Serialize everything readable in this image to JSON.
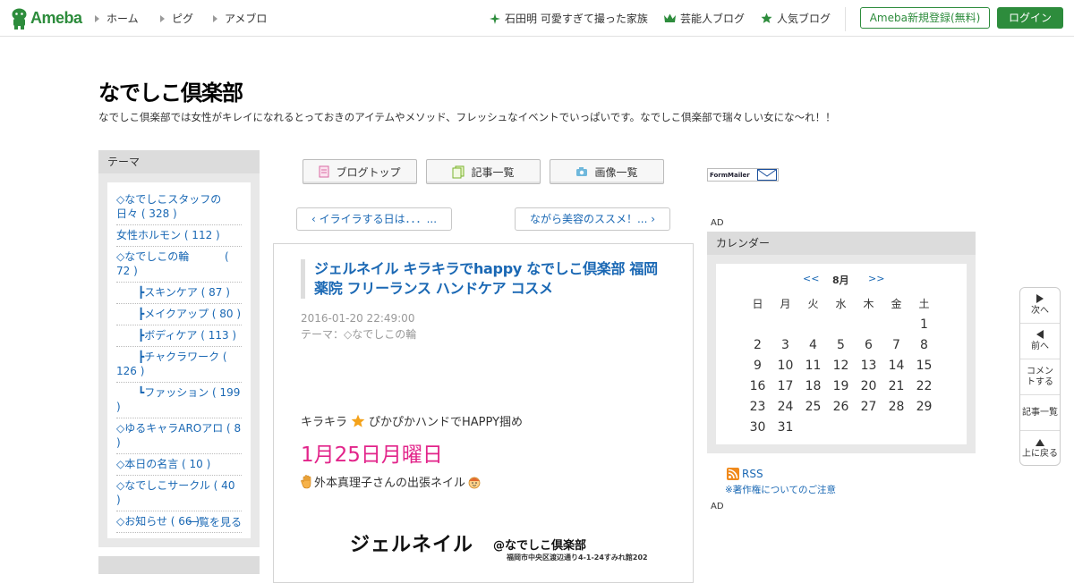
{
  "header": {
    "logo_text": "Ameba",
    "nav": [
      "ホーム",
      "ピグ",
      "アメブロ"
    ],
    "links": [
      {
        "label": "石田明 可愛すぎて撮った家族",
        "icon": "sparkle-icon"
      },
      {
        "label": "芸能人ブログ",
        "icon": "crown-icon"
      },
      {
        "label": "人気ブログ",
        "icon": "star-icon"
      }
    ],
    "register_label": "Ameba新規登録(無料)",
    "login_label": "ログイン",
    "brand_color": "#2d8c3c"
  },
  "blog": {
    "title": "なでしこ倶楽部",
    "description": "なでしこ倶楽部では女性がキレイになれるとっておきのアイテムやメソッド、フレッシュなイベントでいっぱいです。なでしこ倶楽部で瑞々しい女にな〜れ！！"
  },
  "theme": {
    "header": "テーマ",
    "items": [
      "◇なでしこスタッフの日々 ( 328 )",
      "女性ホルモン ( 112 )",
      "◇なでしこの輪　　　 ( 72 )",
      "　　┣スキンケア ( 87 )",
      "　　┣メイクアップ ( 80 )",
      "　　┣ボディケア ( 113 )",
      "　　┣チャクラワーク ( 126 )",
      "　　┗ファッション ( 199 )",
      "◇ゆるキャラAROアロ ( 8 )",
      "◇本日の名言 ( 10 )",
      "◇なでしこサークル ( 40 )",
      "◇お知らせ ( 66 )"
    ],
    "more_label": "一覧を見る"
  },
  "blog_nav": {
    "top": "ブログトップ",
    "list": "記事一覧",
    "images": "画像一覧"
  },
  "pager": {
    "prev": "‹ イライラする日は．．．...",
    "next": "ながら美容のススメ！... ›"
  },
  "article": {
    "title": "ジェルネイル キラキラでhappy なでしこ倶楽部 福岡 薬院 フリーランス ハンドケア コスメ",
    "datetime": "2016-01-20 22:49:00",
    "theme_prefix": "テーマ：",
    "theme_link": "◇なでしこの輪",
    "line1_a": "キラキラ",
    "line1_b": "ぴかぴかハンドでHAPPY掴め",
    "date_big": "1月25日月曜日",
    "line2": "外本真理子さんの出張ネイル",
    "image_title": "ジェルネイル",
    "image_at": "@なでしこ倶楽部",
    "image_addr": "福岡市中央区渡辺通り4-1-24すみれ館202"
  },
  "right": {
    "formmailer": "FormMailer",
    "ad1": "AD",
    "ad2": "AD",
    "calendar": {
      "header": "カレンダー",
      "prev": "<<",
      "month": "8月",
      "next": ">>",
      "weekdays": [
        "日",
        "月",
        "火",
        "水",
        "木",
        "金",
        "土"
      ],
      "weeks": [
        [
          "",
          "",
          "",
          "",
          "",
          "",
          "1"
        ],
        [
          "2",
          "3",
          "4",
          "5",
          "6",
          "7",
          "8"
        ],
        [
          "9",
          "10",
          "11",
          "12",
          "13",
          "14",
          "15"
        ],
        [
          "16",
          "17",
          "18",
          "19",
          "20",
          "21",
          "22"
        ],
        [
          "23",
          "24",
          "25",
          "26",
          "27",
          "28",
          "29"
        ],
        [
          "30",
          "31",
          "",
          "",
          "",
          "",
          ""
        ]
      ]
    },
    "rss": "RSS",
    "copyright_note": "※著作権についてのご注意"
  },
  "side_float": [
    "次へ",
    "前へ",
    "コメントする",
    "記事一覧",
    "上に戻る"
  ]
}
